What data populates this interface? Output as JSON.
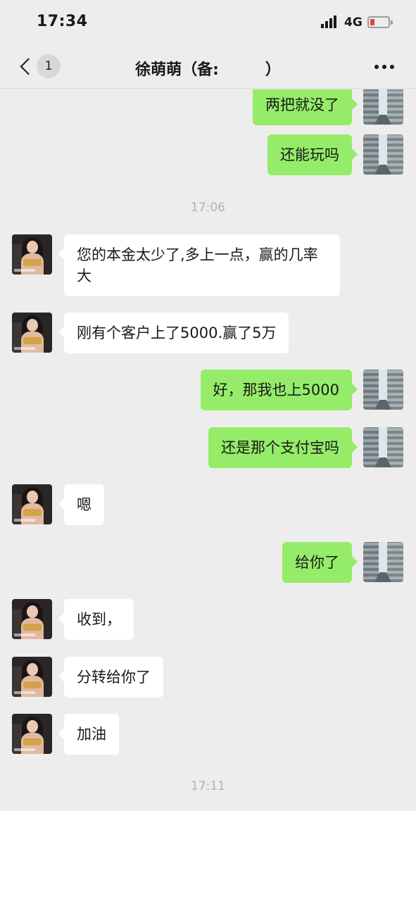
{
  "status_bar": {
    "time": "17:34",
    "network": "4G",
    "battery": "low"
  },
  "header": {
    "back_badge": "1",
    "title": "徐萌萌（备:　　　）"
  },
  "chat": {
    "messages": [
      {
        "side": "out",
        "text": "两把就没了"
      },
      {
        "side": "out",
        "text": "还能玩吗"
      },
      {
        "type": "time",
        "text": "17:06"
      },
      {
        "side": "in",
        "text": "您的本金太少了,多上一点，赢的几率大"
      },
      {
        "side": "in",
        "text": "刚有个客户上了5000.赢了5万"
      },
      {
        "side": "out",
        "text": "好，那我也上5000"
      },
      {
        "side": "out",
        "text": "还是那个支付宝吗"
      },
      {
        "side": "in",
        "text": "嗯"
      },
      {
        "side": "out",
        "text": "给你了"
      },
      {
        "side": "in",
        "text": "收到，"
      },
      {
        "side": "in",
        "text": "分转给你了"
      },
      {
        "side": "in",
        "text": "加油"
      },
      {
        "type": "time",
        "text": "17:11"
      }
    ]
  },
  "colors": {
    "background": "#ededed",
    "outgoing_bubble": "#95ec69",
    "incoming_bubble": "#ffffff",
    "timestamp": "#b2b2b2"
  },
  "icons": [
    "back-chevron-icon",
    "more-icon",
    "signal-icon",
    "battery-icon"
  ]
}
